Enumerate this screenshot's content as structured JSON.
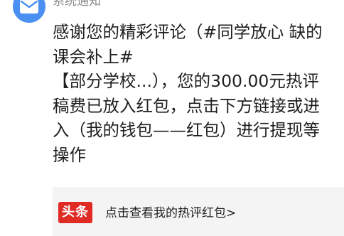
{
  "sender": {
    "name": "系统通知",
    "avatar_icon": "mail-icon",
    "avatar_color": "#4a90f2"
  },
  "message": {
    "lines": [
      "感谢您的精彩评论（#同学放心 缺的",
      "课会补上#",
      "【部分学校...），您的300.00元热评",
      "稿费已放入红包，点击下方链接或进",
      "入（我的钱包——红包）进行提现等",
      "操作"
    ]
  },
  "link_card": {
    "logo_text": "头条",
    "logo_color": "#e02a24",
    "text": "点击查看我的热评红包>"
  }
}
